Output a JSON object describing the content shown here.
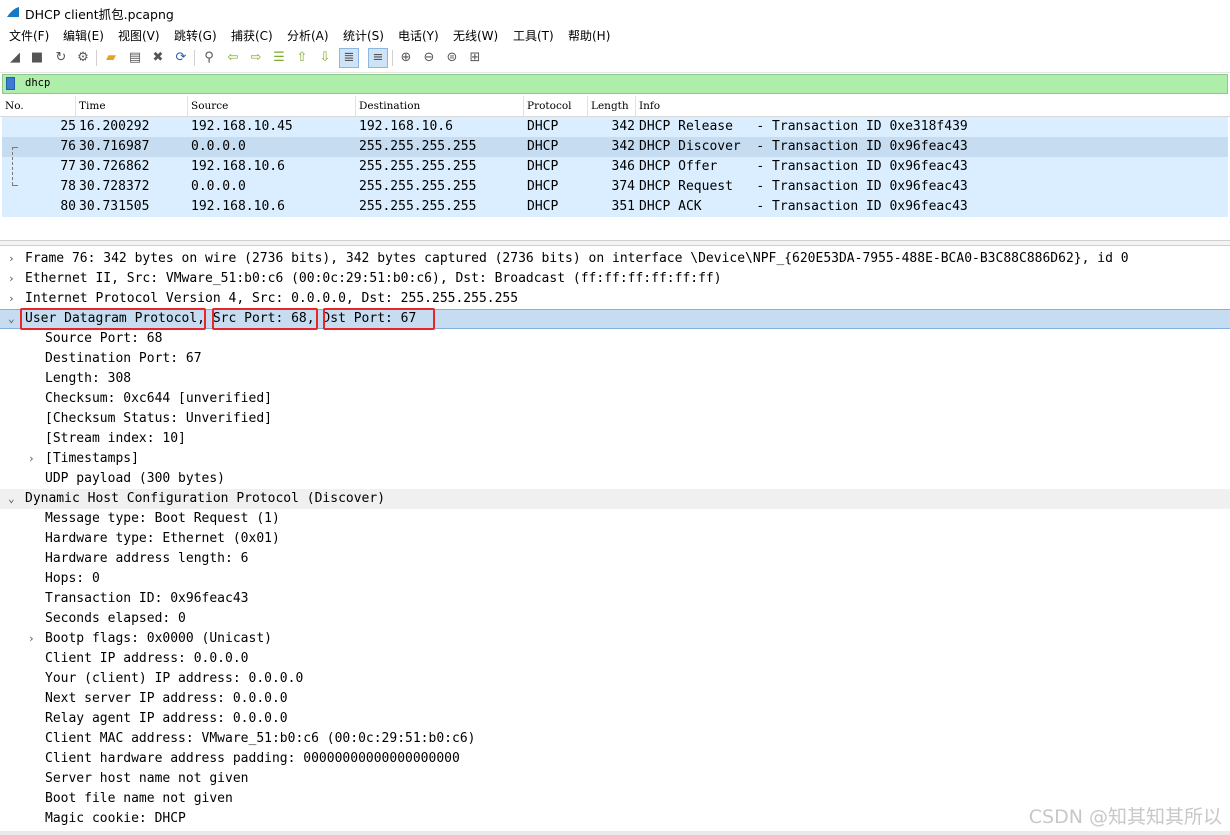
{
  "window": {
    "title": "DHCP client抓包.pcapng"
  },
  "menu": [
    "文件(F)",
    "编辑(E)",
    "视图(V)",
    "跳转(G)",
    "捕获(C)",
    "分析(A)",
    "统计(S)",
    "电话(Y)",
    "无线(W)",
    "工具(T)",
    "帮助(H)"
  ],
  "toolbar": [
    "start-capture-icon",
    "stop-capture-icon",
    "restart-capture-icon",
    "capture-options-icon",
    "open-file-icon",
    "save-file-icon",
    "close-file-icon",
    "reload-icon",
    "find-packet-icon",
    "go-back-icon",
    "go-forward-icon",
    "go-to-packet-icon",
    "first-packet-icon",
    "last-packet-icon",
    "auto-scroll-icon",
    "colorize-icon",
    "zoom-in-icon",
    "zoom-out-icon",
    "zoom-normal-icon",
    "resize-columns-icon"
  ],
  "filter": {
    "value": "dhcp"
  },
  "packet_list": {
    "columns": [
      "No.",
      "Time",
      "Source",
      "Destination",
      "Protocol",
      "Length",
      "Info"
    ],
    "rows": [
      {
        "no": "25",
        "time": "16.200292",
        "source": "192.168.10.45",
        "destination": "192.168.10.6",
        "protocol": "DHCP",
        "length": "342",
        "info": "DHCP Release   - Transaction ID 0xe318f439",
        "selected": false
      },
      {
        "no": "76",
        "time": "30.716987",
        "source": "0.0.0.0",
        "destination": "255.255.255.255",
        "protocol": "DHCP",
        "length": "342",
        "info": "DHCP Discover  - Transaction ID 0x96feac43",
        "selected": true
      },
      {
        "no": "77",
        "time": "30.726862",
        "source": "192.168.10.6",
        "destination": "255.255.255.255",
        "protocol": "DHCP",
        "length": "346",
        "info": "DHCP Offer     - Transaction ID 0x96feac43",
        "selected": false
      },
      {
        "no": "78",
        "time": "30.728372",
        "source": "0.0.0.0",
        "destination": "255.255.255.255",
        "protocol": "DHCP",
        "length": "374",
        "info": "DHCP Request   - Transaction ID 0x96feac43",
        "selected": false
      },
      {
        "no": "80",
        "time": "30.731505",
        "source": "192.168.10.6",
        "destination": "255.255.255.255",
        "protocol": "DHCP",
        "length": "351",
        "info": "DHCP ACK       - Transaction ID 0x96feac43",
        "selected": false
      }
    ]
  },
  "details": [
    {
      "text": "Frame 76: 342 bytes on wire (2736 bits), 342 bytes captured (2736 bits) on interface \\Device\\NPF_{620E53DA-7955-488E-BCA0-B3C88C886D62}, id 0",
      "level": 0,
      "expander": "collapsed"
    },
    {
      "text": "Ethernet II, Src: VMware_51:b0:c6 (00:0c:29:51:b0:c6), Dst: Broadcast (ff:ff:ff:ff:ff:ff)",
      "level": 0,
      "expander": "collapsed"
    },
    {
      "text": "Internet Protocol Version 4, Src: 0.0.0.0, Dst: 255.255.255.255",
      "level": 0,
      "expander": "collapsed"
    },
    {
      "text": "User Datagram Protocol, Src Port: 68, Dst Port: 67",
      "level": 0,
      "expander": "expanded",
      "selected": true
    },
    {
      "text": "Source Port: 68",
      "level": 1
    },
    {
      "text": "Destination Port: 67",
      "level": 1
    },
    {
      "text": "Length: 308",
      "level": 1
    },
    {
      "text": "Checksum: 0xc644 [unverified]",
      "level": 1
    },
    {
      "text": "[Checksum Status: Unverified]",
      "level": 1
    },
    {
      "text": "[Stream index: 10]",
      "level": 1
    },
    {
      "text": "[Timestamps]",
      "level": 1,
      "expander": "collapsed"
    },
    {
      "text": "UDP payload (300 bytes)",
      "level": 1
    },
    {
      "text": "Dynamic Host Configuration Protocol (Discover)",
      "level": 0,
      "expander": "expanded",
      "highlight": true
    },
    {
      "text": "Message type: Boot Request (1)",
      "level": 1
    },
    {
      "text": "Hardware type: Ethernet (0x01)",
      "level": 1
    },
    {
      "text": "Hardware address length: 6",
      "level": 1
    },
    {
      "text": "Hops: 0",
      "level": 1
    },
    {
      "text": "Transaction ID: 0x96feac43",
      "level": 1
    },
    {
      "text": "Seconds elapsed: 0",
      "level": 1
    },
    {
      "text": "Bootp flags: 0x0000 (Unicast)",
      "level": 1,
      "expander": "collapsed"
    },
    {
      "text": "Client IP address: 0.0.0.0",
      "level": 1
    },
    {
      "text": "Your (client) IP address: 0.0.0.0",
      "level": 1
    },
    {
      "text": "Next server IP address: 0.0.0.0",
      "level": 1
    },
    {
      "text": "Relay agent IP address: 0.0.0.0",
      "level": 1
    },
    {
      "text": "Client MAC address: VMware_51:b0:c6 (00:0c:29:51:b0:c6)",
      "level": 1
    },
    {
      "text": "Client hardware address padding: 00000000000000000000",
      "level": 1
    },
    {
      "text": "Server host name not given",
      "level": 1
    },
    {
      "text": "Boot file name not given",
      "level": 1
    },
    {
      "text": "Magic cookie: DHCP",
      "level": 1
    }
  ],
  "watermark": "CSDN @知其知其所以",
  "colors": {
    "selected_row": "#c6dcf1",
    "udp_row": "#daeeff",
    "filter_bg": "#afeeaa",
    "annotation_red": "#e8262a"
  }
}
